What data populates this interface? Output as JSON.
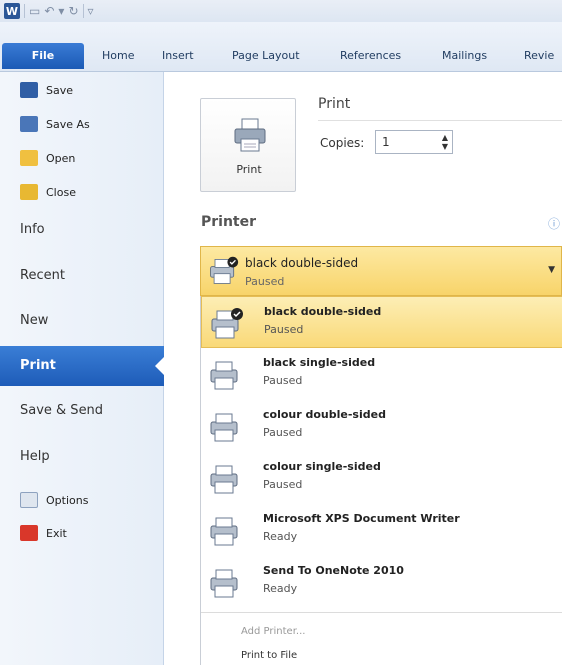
{
  "app": {
    "icon_letter": "W"
  },
  "ribbon": {
    "tabs": [
      "File",
      "Home",
      "Insert",
      "Page Layout",
      "References",
      "Mailings",
      "Revie"
    ]
  },
  "backstage": {
    "commands": [
      {
        "label": "Save",
        "icon": "save-icon"
      },
      {
        "label": "Save As",
        "icon": "save-as-icon"
      },
      {
        "label": "Open",
        "icon": "open-folder-icon"
      },
      {
        "label": "Close",
        "icon": "close-folder-icon"
      }
    ],
    "sections": [
      "Info",
      "Recent",
      "New",
      "Print",
      "Save & Send",
      "Help"
    ],
    "footer_commands": [
      {
        "label": "Options",
        "icon": "options-icon"
      },
      {
        "label": "Exit",
        "icon": "exit-icon"
      }
    ]
  },
  "print_pane": {
    "heading": "Print",
    "button_label": "Print",
    "copies_label": "Copies:",
    "copies_value": "1",
    "printer_heading": "Printer",
    "selected_printer": {
      "name": "black double-sided",
      "status": "Paused"
    },
    "printers": [
      {
        "name": "black double-sided",
        "status": "Paused"
      },
      {
        "name": "black single-sided",
        "status": "Paused"
      },
      {
        "name": "colour double-sided",
        "status": "Paused"
      },
      {
        "name": "colour single-sided",
        "status": "Paused"
      },
      {
        "name": "Microsoft XPS Document Writer",
        "status": "Ready"
      },
      {
        "name": "Send To OneNote 2010",
        "status": "Ready"
      }
    ],
    "add_printer": "Add Printer...",
    "print_to_file": "Print to File"
  }
}
